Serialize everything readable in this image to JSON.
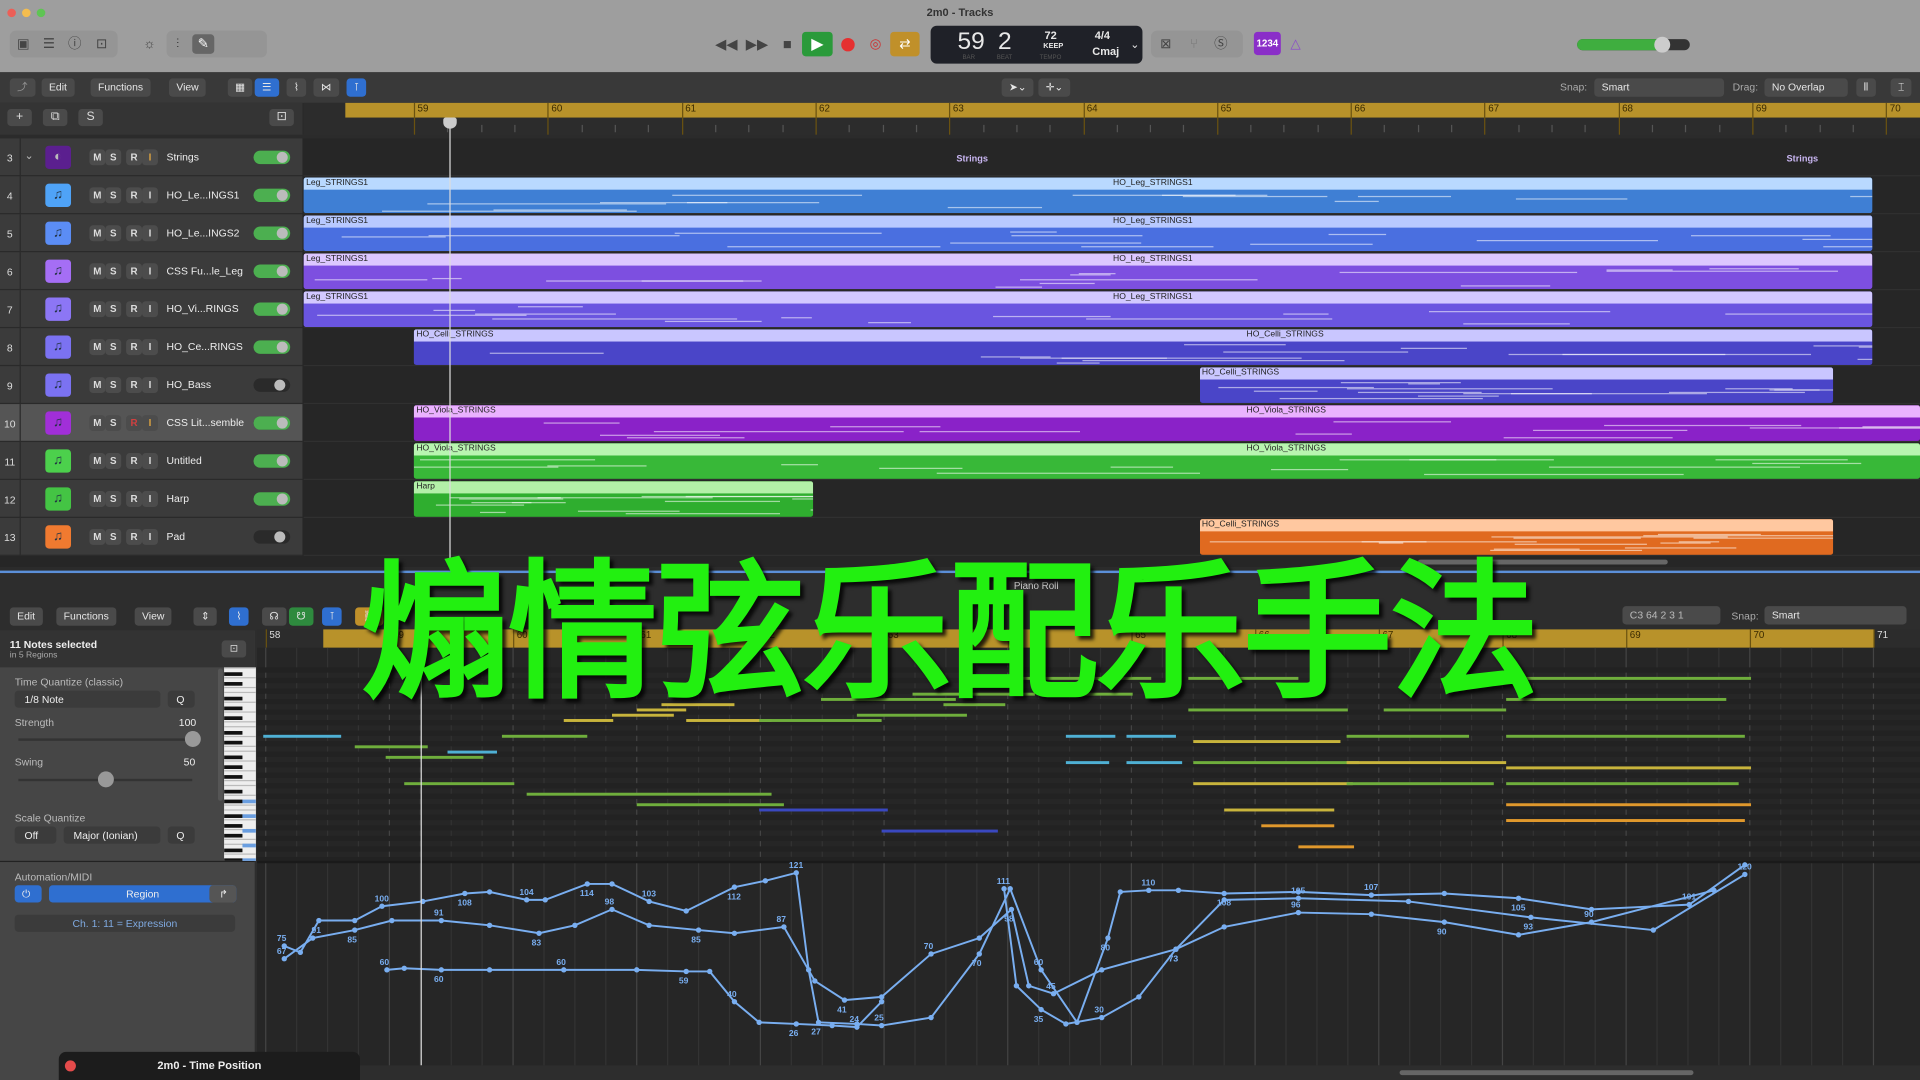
{
  "window": {
    "title": "2m0 - Tracks"
  },
  "lcd": {
    "bar": "59",
    "beat": "2",
    "bar_label": "BAR",
    "beat_label": "BEAT",
    "tempo": "72",
    "tempo_mode": "KEEP",
    "tempo_label": "TEMPO",
    "signature": "4/4",
    "key": "Cmaj"
  },
  "count_in": "1234",
  "master_volume": 0.75,
  "tracks_toolbar": {
    "edit": "Edit",
    "functions": "Functions",
    "view": "View",
    "snap_label": "Snap:",
    "snap_value": "Smart",
    "drag_label": "Drag:",
    "drag_value": "No Overlap"
  },
  "track_header": {
    "add": "+",
    "duplicate": "⧉",
    "solo": "S"
  },
  "ruler": {
    "bars": [
      "59",
      "60",
      "61",
      "62",
      "63",
      "64",
      "65",
      "66",
      "67",
      "68",
      "69",
      "70"
    ]
  },
  "buttons": {
    "m": "M",
    "s": "S",
    "r": "R",
    "i": "I"
  },
  "tracks": [
    {
      "num": "3",
      "name": "Strings",
      "color": "#5b1f8f",
      "folder": true,
      "on": true
    },
    {
      "num": "4",
      "name": "HO_Le...INGS1",
      "color": "#4fa3f7",
      "on": true
    },
    {
      "num": "5",
      "name": "HO_Le...INGS2",
      "color": "#5b8df5",
      "on": true
    },
    {
      "num": "6",
      "name": "CSS Fu...le_Leg",
      "color": "#a56ef5",
      "on": true
    },
    {
      "num": "7",
      "name": "HO_Vi...RINGS",
      "color": "#8c76f5",
      "on": true
    },
    {
      "num": "8",
      "name": "HO_Ce...RINGS",
      "color": "#7b72f2",
      "on": true
    },
    {
      "num": "9",
      "name": "HO_Bass",
      "color": "#7b72f2",
      "on": false
    },
    {
      "num": "10",
      "name": "CSS Lit...semble",
      "color": "#a12fd8",
      "on": true,
      "selected": true
    },
    {
      "num": "11",
      "name": "Untitled",
      "color": "#4cd04c",
      "on": true
    },
    {
      "num": "12",
      "name": "Harp",
      "color": "#44c444",
      "on": true
    },
    {
      "num": "13",
      "name": "Pad",
      "color": "#f07a30",
      "on": false
    }
  ],
  "folder_labels": [
    "Strings",
    "Strings"
  ],
  "regions": [
    {
      "track": 1,
      "start": 58.1,
      "end": 69.9,
      "labels": [
        "Leg_STRINGS1",
        "HO_Leg_STRINGS1"
      ],
      "head": "#b9d9ff",
      "body": "#3f7fd4"
    },
    {
      "track": 2,
      "start": 58.1,
      "end": 69.9,
      "labels": [
        "Leg_STRINGS1",
        "HO_Leg_STRINGS1"
      ],
      "head": "#b8c9ff",
      "body": "#4a6fe0"
    },
    {
      "track": 3,
      "start": 58.1,
      "end": 69.9,
      "labels": [
        "Leg_STRINGS1",
        "HO_Leg_STRINGS1"
      ],
      "head": "#dcc7ff",
      "body": "#7d4fe0"
    },
    {
      "track": 4,
      "start": 58.1,
      "end": 69.9,
      "labels": [
        "Leg_STRINGS1",
        "HO_Leg_STRINGS1"
      ],
      "head": "#d2c8ff",
      "body": "#6a55e0"
    },
    {
      "track": 5,
      "start": 59.0,
      "end": 69.9,
      "labels": [
        "HO_Celli_STRINGS",
        "HO_Celli_STRINGS"
      ],
      "head": "#c9c6ff",
      "body": "#4a45c8"
    },
    {
      "track": 6,
      "start": 64.87,
      "end": 69.6,
      "labels": [
        "HO_Celli_STRINGS"
      ],
      "head": "#c9c6ff",
      "body": "#4a45c8"
    },
    {
      "track": 7,
      "start": 59.0,
      "end": 71.0,
      "labels": [
        "HO_Viola_STRINGS",
        "HO_Viola_STRINGS"
      ],
      "head": "#eab2ff",
      "body": "#8a22c8"
    },
    {
      "track": 8,
      "start": 59.0,
      "end": 71.0,
      "labels": [
        "HO_Viola_STRINGS",
        "HO_Viola_STRINGS"
      ],
      "head": "#b8f5b0",
      "body": "#38b838"
    },
    {
      "track": 9,
      "start": 59.0,
      "end": 61.98,
      "labels": [
        "Harp"
      ],
      "head": "#b3f0a8",
      "body": "#2fae2f"
    },
    {
      "track": 10,
      "start": 64.87,
      "end": 69.6,
      "labels": [
        "HO_Celli_STRINGS"
      ],
      "head": "#ffc8a0",
      "body": "#e06a20"
    }
  ],
  "overlay_text": "煽情弦乐配乐手法",
  "piano_roll": {
    "edit": "Edit",
    "functions": "Functions",
    "view": "View",
    "title": "Piano Roll",
    "position": "C3   64 2 3 1",
    "snap_label": "Snap:",
    "snap_value": "Smart",
    "ruler_bars": [
      "58",
      "59",
      "60",
      "61",
      "62",
      "63",
      "64",
      "65",
      "66",
      "67",
      "68",
      "69",
      "70",
      "71"
    ],
    "selection": "11 Notes selected",
    "selection_sub": "in 5 Regions",
    "time_quantize_label": "Time Quantize (classic)",
    "time_quantize_value": "1/8 Note",
    "q": "Q",
    "strength_label": "Strength",
    "strength_value": "100",
    "strength": 100,
    "swing_label": "Swing",
    "swing_value": "50",
    "swing": 50,
    "scale_quantize_label": "Scale Quantize",
    "scale_off": "Off",
    "scale_value": "Major (Ionian)",
    "automation_label": "Automation/MIDI",
    "automation_mode": "Region",
    "automation_param": "Ch. 1: 11 = Expression"
  },
  "notes": [
    [
      57.98,
      0.63,
      71,
      "c"
    ],
    [
      58.72,
      0.59,
      69,
      "g"
    ],
    [
      58.97,
      0.79,
      67,
      "g"
    ],
    [
      59.12,
      0.89,
      62,
      "g"
    ],
    [
      59.47,
      0.4,
      68,
      "c"
    ],
    [
      59.91,
      0.69,
      71,
      "g"
    ],
    [
      60.41,
      0.4,
      74,
      "y"
    ],
    [
      60.8,
      0.5,
      75,
      "y"
    ],
    [
      61.0,
      0.4,
      76,
      "y"
    ],
    [
      61.2,
      0.59,
      77,
      "y"
    ],
    [
      61.4,
      0.69,
      74,
      "y"
    ],
    [
      61.99,
      0.99,
      74,
      "g"
    ],
    [
      62.49,
      1.09,
      78,
      "g"
    ],
    [
      62.78,
      0.89,
      75,
      "g"
    ],
    [
      63.23,
      0.99,
      79,
      "g"
    ],
    [
      60.11,
      1.98,
      60,
      "g"
    ],
    [
      61.0,
      1.19,
      58,
      "g"
    ],
    [
      61.99,
      1.04,
      57,
      "b"
    ],
    [
      62.98,
      0.94,
      53,
      "b"
    ],
    [
      63.48,
      0.5,
      77,
      "g"
    ],
    [
      63.77,
      1.39,
      82,
      "g"
    ],
    [
      64.27,
      0.74,
      79,
      "g"
    ],
    [
      64.47,
      0.4,
      71,
      "c"
    ],
    [
      64.47,
      0.35,
      66,
      "c"
    ],
    [
      64.96,
      0.4,
      71,
      "c"
    ],
    [
      64.96,
      0.45,
      66,
      "c"
    ],
    [
      65.46,
      0.89,
      82,
      "g"
    ],
    [
      65.46,
      1.29,
      76,
      "g"
    ],
    [
      65.5,
      1.19,
      70,
      "y"
    ],
    [
      65.5,
      1.34,
      66,
      "g"
    ],
    [
      65.5,
      1.29,
      62,
      "y"
    ],
    [
      65.75,
      0.89,
      57,
      "y"
    ],
    [
      66.05,
      0.59,
      54,
      "o"
    ],
    [
      66.35,
      0.45,
      50,
      "o"
    ],
    [
      66.74,
      0.99,
      71,
      "g"
    ],
    [
      66.74,
      1.29,
      66,
      "y"
    ],
    [
      66.74,
      1.19,
      62,
      "g"
    ],
    [
      67.04,
      0.99,
      76,
      "g"
    ],
    [
      68.03,
      1.98,
      82,
      "g"
    ],
    [
      68.03,
      1.78,
      78,
      "g"
    ],
    [
      68.03,
      1.93,
      71,
      "g"
    ],
    [
      68.03,
      1.98,
      65,
      "y"
    ],
    [
      68.03,
      1.88,
      62,
      "g"
    ],
    [
      68.03,
      1.98,
      58,
      "o"
    ],
    [
      68.03,
      1.93,
      55,
      "o"
    ]
  ],
  "note_colors": {
    "g": "#6fae3c",
    "y": "#c8b43c",
    "c": "#4fb0d4",
    "b": "#3a48c0",
    "o": "#e0982c"
  },
  "automation": {
    "color": "#79aef0",
    "series": [
      [
        [
          58.15,
          75
        ],
        [
          58.28,
          71
        ],
        [
          58.43,
          91
        ],
        [
          58.72,
          91
        ],
        [
          58.94,
          100
        ],
        [
          59.27,
          103
        ],
        [
          59.61,
          108
        ],
        [
          59.81,
          109
        ],
        [
          60.11,
          104
        ],
        [
          60.26,
          104
        ],
        [
          60.6,
          114
        ],
        [
          60.8,
          114
        ],
        [
          61.1,
          103
        ],
        [
          61.4,
          97
        ],
        [
          61.79,
          112
        ],
        [
          62.04,
          116
        ],
        [
          62.29,
          121
        ],
        [
          62.39,
          60
        ],
        [
          62.47,
          27
        ],
        [
          62.78,
          26
        ],
        [
          62.98,
          25
        ],
        [
          63.38,
          30
        ],
        [
          63.77,
          70
        ],
        [
          64.02,
          111
        ],
        [
          64.27,
          60
        ],
        [
          64.56,
          27
        ],
        [
          64.81,
          80
        ],
        [
          64.91,
          109
        ],
        [
          65.14,
          110
        ],
        [
          65.38,
          110
        ],
        [
          65.75,
          108
        ],
        [
          66.35,
          109
        ],
        [
          66.94,
          107
        ],
        [
          67.53,
          108
        ],
        [
          68.13,
          105
        ],
        [
          68.72,
          98
        ],
        [
          69.51,
          101
        ],
        [
          69.96,
          126
        ]
      ],
      [
        [
          58.15,
          67
        ],
        [
          58.38,
          80
        ],
        [
          58.72,
          85
        ],
        [
          59.02,
          91
        ],
        [
          59.42,
          91
        ],
        [
          59.81,
          88
        ],
        [
          60.21,
          83
        ],
        [
          60.5,
          88
        ],
        [
          60.8,
          98
        ],
        [
          61.1,
          88
        ],
        [
          61.5,
          85
        ],
        [
          61.79,
          83
        ],
        [
          62.19,
          87
        ],
        [
          62.44,
          53
        ],
        [
          62.68,
          41
        ],
        [
          62.98,
          43
        ],
        [
          63.38,
          70
        ],
        [
          63.77,
          80
        ],
        [
          64.03,
          98
        ],
        [
          64.17,
          50
        ],
        [
          64.37,
          45
        ],
        [
          64.76,
          60
        ],
        [
          65.36,
          73
        ],
        [
          65.75,
          87
        ],
        [
          66.35,
          96
        ],
        [
          66.94,
          95
        ],
        [
          67.53,
          90
        ],
        [
          68.13,
          82
        ],
        [
          68.72,
          90
        ],
        [
          69.71,
          110
        ]
      ],
      [
        [
          58.98,
          60
        ],
        [
          59.12,
          61
        ],
        [
          59.42,
          60
        ],
        [
          59.81,
          60
        ],
        [
          60.41,
          60
        ],
        [
          61.0,
          60
        ],
        [
          61.4,
          59
        ],
        [
          61.59,
          59
        ],
        [
          61.79,
          40
        ],
        [
          61.99,
          27
        ],
        [
          62.29,
          26
        ],
        [
          62.58,
          25
        ],
        [
          62.78,
          24
        ],
        [
          62.98,
          40
        ]
      ],
      [
        [
          63.97,
          111
        ],
        [
          64.07,
          50
        ],
        [
          64.27,
          35
        ],
        [
          64.47,
          26
        ],
        [
          64.76,
          30
        ],
        [
          65.06,
          43
        ],
        [
          65.36,
          73
        ],
        [
          65.75,
          104
        ],
        [
          66.35,
          105
        ],
        [
          67.24,
          103
        ],
        [
          68.23,
          93
        ],
        [
          69.22,
          85
        ],
        [
          69.96,
          120
        ]
      ]
    ]
  },
  "floating_window": {
    "title": "2m0 - Time Position"
  }
}
